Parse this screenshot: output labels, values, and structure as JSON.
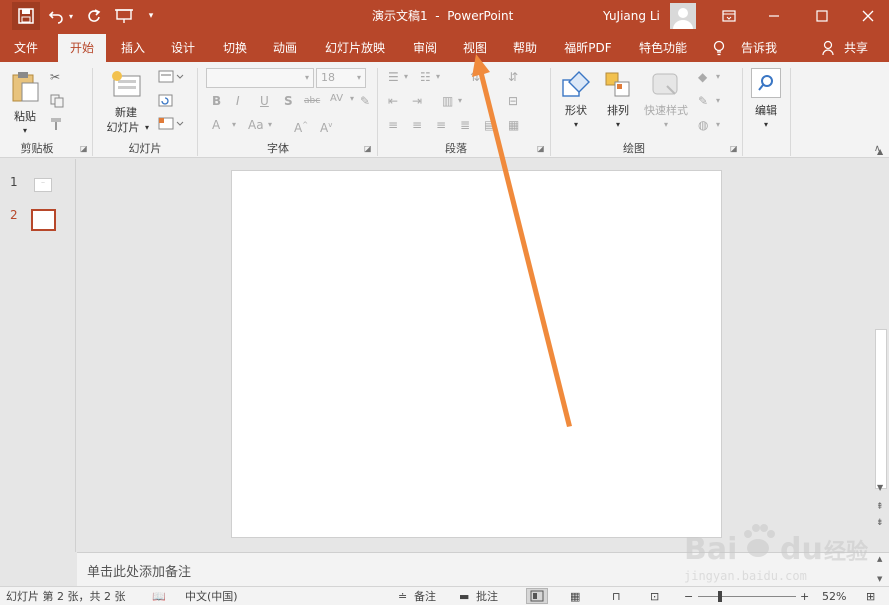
{
  "window": {
    "title": "演示文稿1  -  PowerPoint",
    "user": "YuJiang Li"
  },
  "tabs": [
    "文件",
    "开始",
    "插入",
    "设计",
    "切换",
    "动画",
    "幻灯片放映",
    "审阅",
    "视图",
    "帮助",
    "福昕PDF",
    "特色功能",
    "告诉我",
    "共享"
  ],
  "ribbon": {
    "clipboard": {
      "paste": "粘贴",
      "group": "剪贴板"
    },
    "slides": {
      "new_slide_line1": "新建",
      "new_slide_line2": "幻灯片",
      "group": "幻灯片"
    },
    "font": {
      "font_name": "",
      "font_size": "18",
      "group": "字体"
    },
    "paragraph": {
      "group": "段落"
    },
    "drawing": {
      "shapes": "形状",
      "arrange": "排列",
      "quick_styles": "快速样式",
      "group": "绘图"
    },
    "editing": {
      "edit": "编辑"
    }
  },
  "slide_pane": {
    "items": [
      {
        "num": "1"
      },
      {
        "num": "2"
      }
    ]
  },
  "notes": {
    "placeholder": "单击此处添加备注"
  },
  "status": {
    "slide_info": "幻灯片 第 2 张，共 2 张",
    "language": "中文(中国)",
    "notes_btn": "备注",
    "comments_btn": "批注",
    "zoom": "52%"
  },
  "watermark": {
    "brand": "Baidu经验",
    "url": "jingyan.baidu.com"
  },
  "colors": {
    "accent": "#b7472a",
    "arrow": "#f08a3c"
  }
}
